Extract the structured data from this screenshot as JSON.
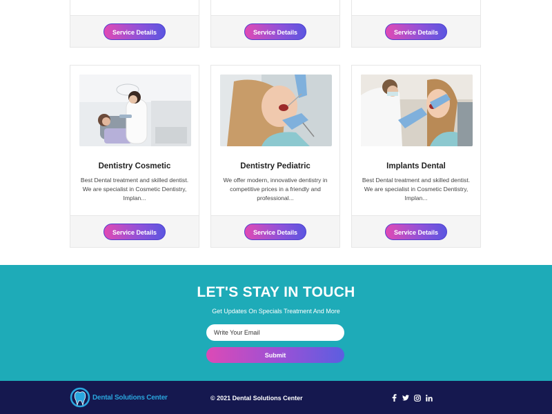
{
  "cards_top": [
    {
      "button": "Service Details"
    },
    {
      "button": "Service Details"
    },
    {
      "button": "Service Details"
    }
  ],
  "cards": [
    {
      "title": "Dentistry Cosmetic",
      "text": "Best Dental treatment and skilled dentist. We are specialist in Cosmetic Dentistry, Implan...",
      "button": "Service Details"
    },
    {
      "title": "Dentistry Pediatric",
      "text": "We offer modern, innovative dentistry in competitive prices in a friendly and professional...",
      "button": "Service Details"
    },
    {
      "title": "Implants Dental",
      "text": "Best Dental treatment and skilled dentist. We are specialist in Cosmetic Dentistry, Implan...",
      "button": "Service Details"
    }
  ],
  "newsletter": {
    "heading": "LET'S STAY IN TOUCH",
    "subheading": "Get Updates On Specials Treatment And More",
    "email_placeholder": "Write Your Email",
    "submit_label": "Submit"
  },
  "footer": {
    "logo_text": "Dental Solutions Center",
    "copyright": "© 2021 Dental Solutions Center",
    "social": [
      "facebook-icon",
      "twitter-icon",
      "instagram-icon",
      "linkedin-icon"
    ]
  },
  "colors": {
    "newsletter_bg": "#1eabb8",
    "footer_bg": "#15184f",
    "gradient_start": "#e04ab4",
    "gradient_end": "#5b56e0",
    "logo": "#2aa6de"
  }
}
